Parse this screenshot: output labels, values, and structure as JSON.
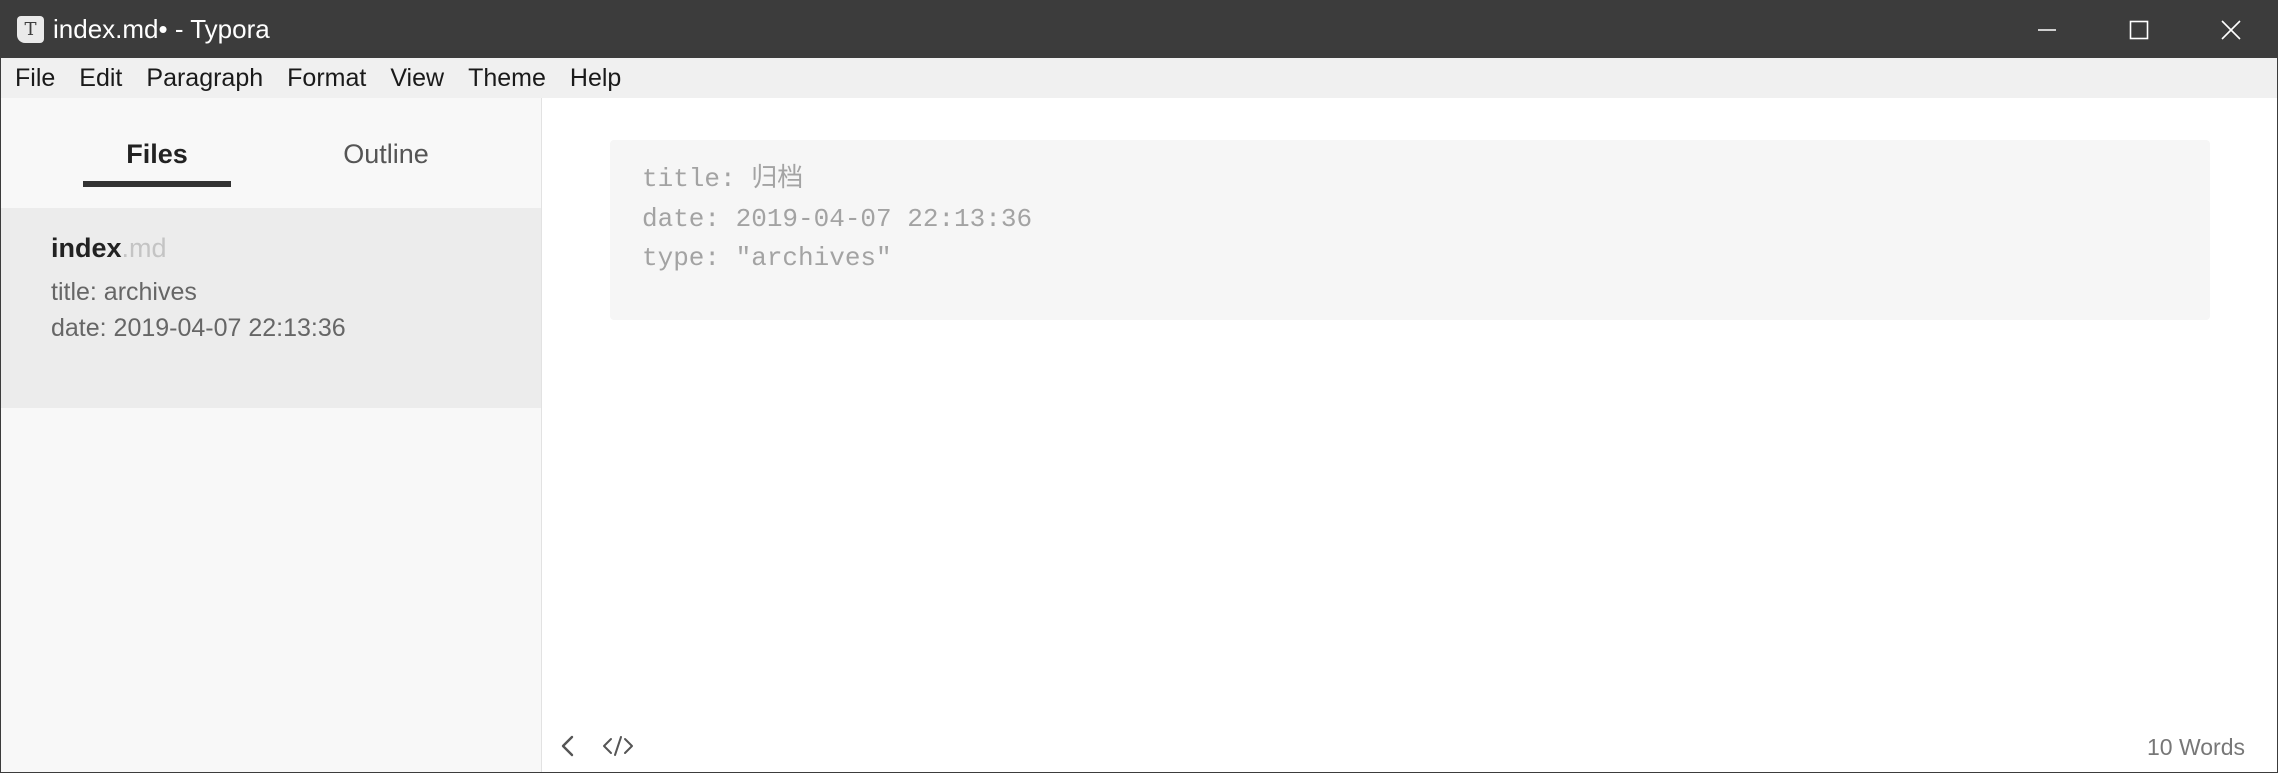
{
  "window": {
    "title": "index.md• - Typora",
    "app_icon_letter": "T",
    "controls": [
      "minimize-icon",
      "maximize-icon",
      "close-icon"
    ]
  },
  "menu": {
    "items": [
      "File",
      "Edit",
      "Paragraph",
      "Format",
      "View",
      "Theme",
      "Help"
    ]
  },
  "sidebar": {
    "tabs": {
      "files": "Files",
      "outline": "Outline",
      "active": "Files"
    },
    "files": [
      {
        "name": "index",
        "ext": ".md",
        "excerpt": [
          "title: archives",
          "date: 2019-04-07 22:13:36"
        ]
      }
    ]
  },
  "editor": {
    "front_matter": [
      "title: 归档",
      "date: 2019-04-07 22:13:36",
      "type: \"archives\""
    ]
  },
  "status": {
    "toggle_sidebar_icon": "chevron-left-icon",
    "source_mode_icon": "code-icon",
    "word_count": "10 Words"
  },
  "colors": {
    "titlebar": "#3c3c3c",
    "menubar": "#f0f0f0",
    "sidebar": "#f8f8f8",
    "selected_file": "#ececec",
    "front_matter_bg": "#f6f6f6"
  }
}
